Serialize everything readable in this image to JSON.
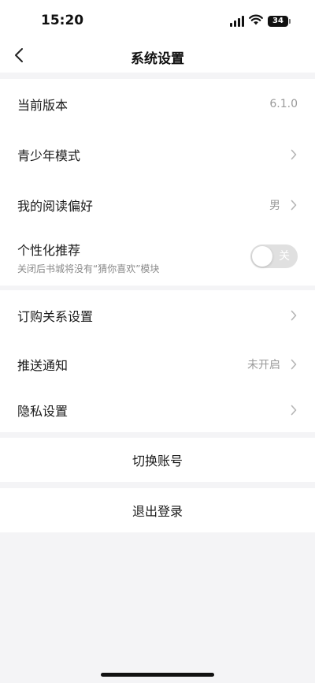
{
  "status": {
    "time": "15:20",
    "battery": "34"
  },
  "nav": {
    "title": "系统设置"
  },
  "settings": {
    "version": {
      "label": "当前版本",
      "value": "6.1.0"
    },
    "teen_mode": {
      "label": "青少年模式"
    },
    "reading_pref": {
      "label": "我的阅读偏好",
      "value": "男"
    },
    "personalized": {
      "label": "个性化推荐",
      "description": "关闭后书城将没有“猜你喜欢”模块",
      "toggle_text": "关",
      "enabled": false
    },
    "subscription": {
      "label": "订购关系设置"
    },
    "push": {
      "label": "推送通知",
      "value": "未开启"
    },
    "privacy": {
      "label": "隐私设置"
    }
  },
  "actions": {
    "switch_account": "切换账号",
    "logout": "退出登录"
  },
  "icons": {
    "back": "back-chevron-icon",
    "chevron": "chevron-right-icon",
    "wifi": "wifi-icon",
    "signal": "cellular-signal-icon",
    "battery": "battery-icon"
  },
  "colors": {
    "background": "#f4f4f6",
    "card": "#ffffff",
    "text": "#1b1b1b",
    "secondary_text": "#9a9a9a",
    "toggle_off": "#e0e0e0"
  }
}
